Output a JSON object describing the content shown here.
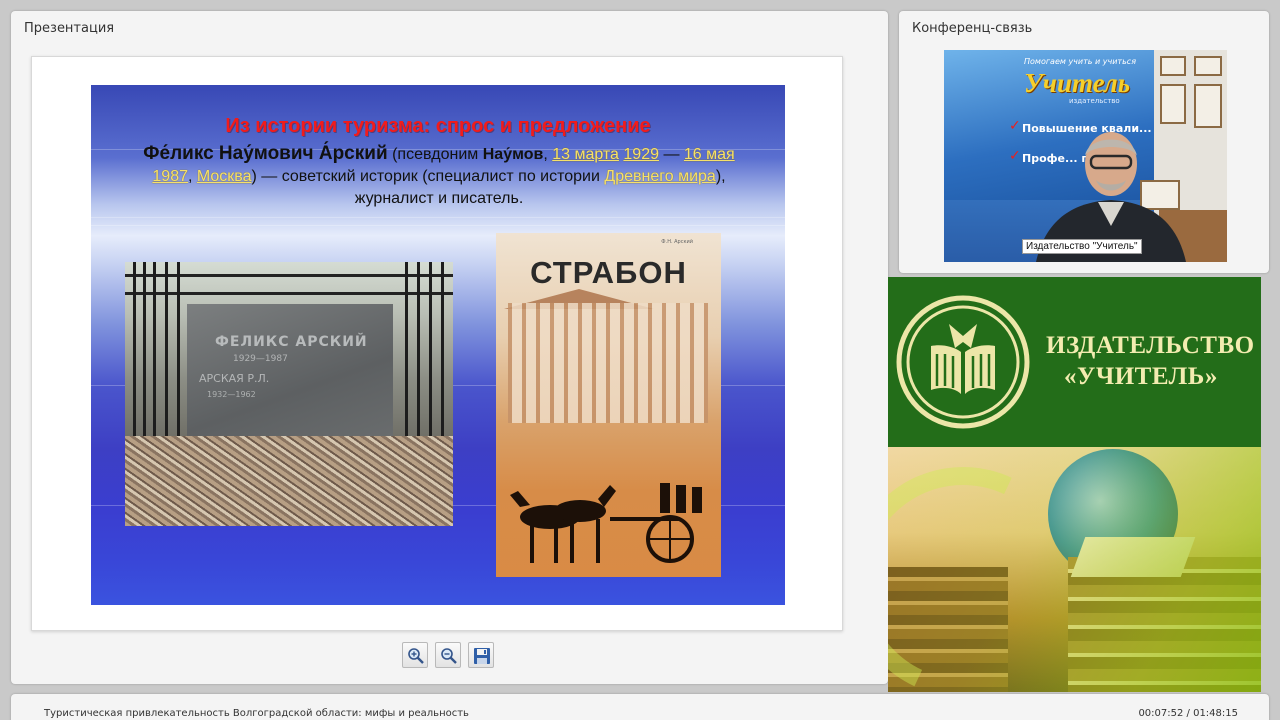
{
  "presentation": {
    "panel_title": "Презентация",
    "slide": {
      "heading": "Из истории туризма: спрос и предложение",
      "name": "Фе́ликс Нау́мович А́рский",
      "pseudonym_prefix": " (псевдоним ",
      "pseudonym": "Нау́мов",
      "sep1": ", ",
      "birth_day": "13 марта",
      "birth_year": "1929",
      "dash1": " — ",
      "death_day": "16 мая",
      "death_year": "1987",
      "sep2": ", ",
      "city": "Москва",
      "desc1": ") — советский историк (специалист по истории ",
      "ancient": "Древнего мира",
      "desc2": "), журналист и писатель.",
      "grave_inscription": {
        "line1": "ФЕЛИКС АРСКИЙ",
        "line2": "1929—1987",
        "line3": "АРСКАЯ Р.Л.",
        "line4": "1932—1962"
      },
      "book_cover_title": "СТРАБОН",
      "book_cover_author": "Ф.Н. Арский"
    },
    "toolbar": {
      "zoom_in_icon": "zoom-in-icon",
      "zoom_out_icon": "zoom-out-icon",
      "save_icon": "save-icon"
    }
  },
  "conference": {
    "panel_title": "Конференц-связь",
    "video": {
      "banner_slogan": "Помогаем учить и учиться",
      "banner_logo": "Учитель",
      "banner_sub": "издательство",
      "banner_check1": "Повышение квали...",
      "banner_check2": "Профе... подго...",
      "name_tag": "Издательство \"Учитель\""
    }
  },
  "publisher_banner": {
    "line1": "ИЗДАТЕЛЬСТВО",
    "line2": "«УЧИТЕЛЬ»"
  },
  "footer": {
    "talk_title": "Туристическая привлекательность Волгоградской области: мифы и реальность",
    "time": "00:07:52 / 01:48:15"
  },
  "colors": {
    "banner_green": "#236d19",
    "heading_red": "#f21b1b",
    "link_yellow": "#f6e16a"
  }
}
